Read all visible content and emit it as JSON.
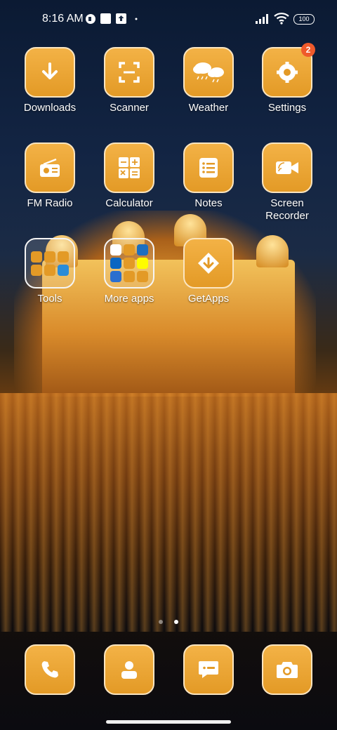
{
  "status_bar": {
    "time": "8:16 AM",
    "battery": "100",
    "icons": [
      "vpn-icon",
      "square-notification-icon",
      "upload-icon",
      "dot-icon",
      "signal-icon",
      "wifi-icon"
    ]
  },
  "apps": {
    "downloads": {
      "label": "Downloads",
      "icon": "download-arrow-icon"
    },
    "scanner": {
      "label": "Scanner",
      "icon": "scanner-frame-icon"
    },
    "weather": {
      "label": "Weather",
      "icon": "cloud-rain-icon"
    },
    "settings": {
      "label": "Settings",
      "icon": "gear-icon",
      "badge": "2"
    },
    "fm_radio": {
      "label": "FM Radio",
      "icon": "radio-icon"
    },
    "calculator": {
      "label": "Calculator",
      "icon": "calculator-icon"
    },
    "notes": {
      "label": "Notes",
      "icon": "notes-list-icon"
    },
    "screen_recorder": {
      "label": "Screen Recorder",
      "icon": "video-camera-icon"
    },
    "tools": {
      "label": "Tools",
      "icon": "folder-icon"
    },
    "more_apps": {
      "label": "More apps",
      "icon": "folder-icon"
    },
    "getapps": {
      "label": "GetApps",
      "icon": "getapps-diamond-icon"
    }
  },
  "page_indicator": {
    "pages": 2,
    "active": 2
  },
  "dock": {
    "phone": {
      "icon": "phone-icon"
    },
    "contacts": {
      "icon": "contacts-icon"
    },
    "messages": {
      "icon": "message-icon"
    },
    "camera": {
      "icon": "camera-icon"
    }
  },
  "colors": {
    "accent": "#E39A26",
    "badge": "#EF5A2B"
  }
}
